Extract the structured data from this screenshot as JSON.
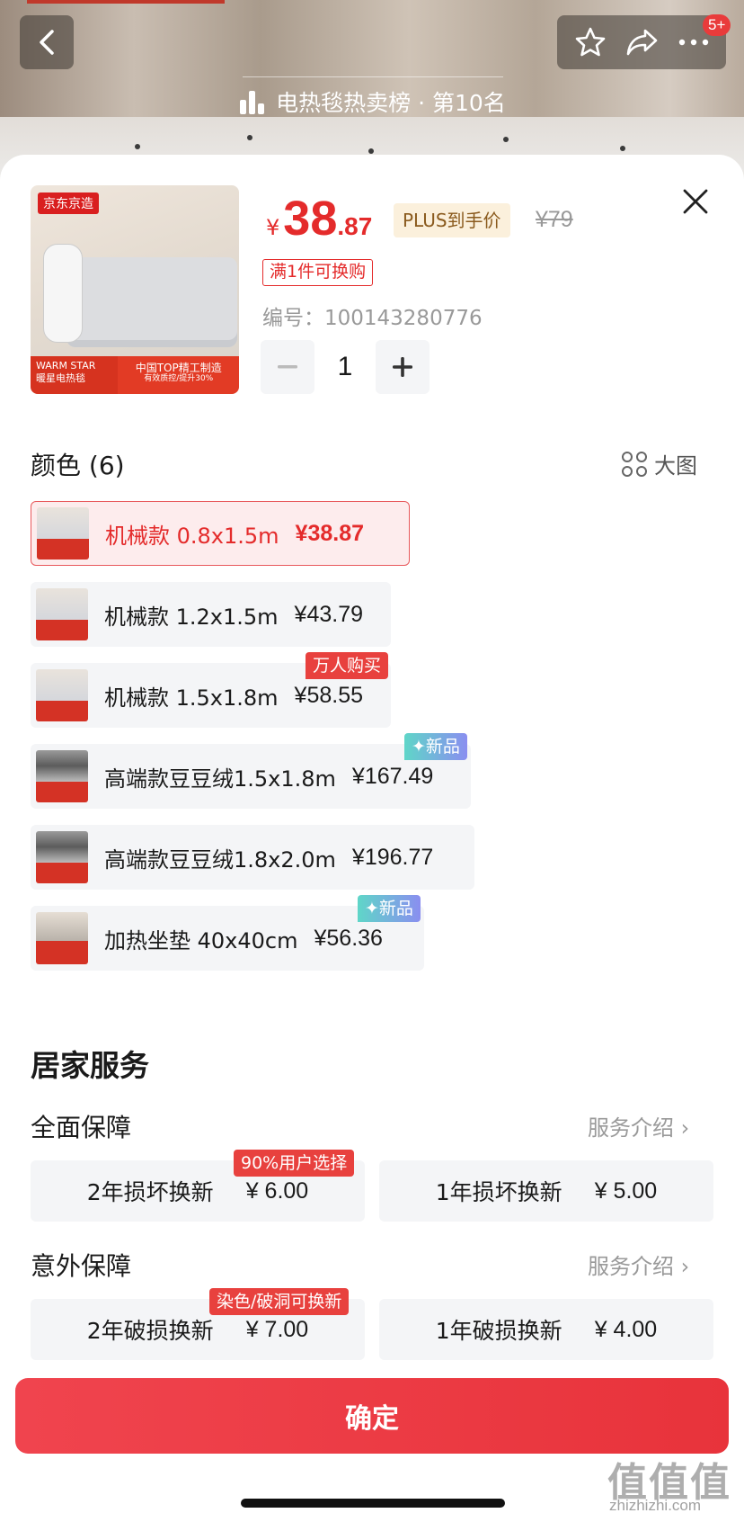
{
  "nav": {
    "badge": "5+",
    "rank_text": "电热毯热卖榜 · 第10名"
  },
  "product": {
    "price_symbol": "¥",
    "price_int": "38",
    "price_dec": ".87",
    "plus_label": "PLUS到手价",
    "original_price": "¥79",
    "promo": "满1件可换购",
    "sku_code": "编号：100143280776",
    "quantity": "1",
    "thumb": {
      "logo": "京东京造",
      "bar_left_1": "WARM STAR",
      "bar_left_2": "暖星电热毯",
      "bar_right_1": "中国TOP精工制造",
      "bar_right_2": "有效质控/提升30%"
    }
  },
  "color_section": {
    "title": "颜色 (6)",
    "big_view": "大图",
    "options": [
      {
        "name": "机械款 0.8x1.5m",
        "price": "¥38.87",
        "selected": true,
        "badge": ""
      },
      {
        "name": "机械款 1.2x1.5m",
        "price": "¥43.79",
        "selected": false,
        "badge": ""
      },
      {
        "name": "机械款 1.5x1.8m",
        "price": "¥58.55",
        "selected": false,
        "badge": "万人购买"
      },
      {
        "name": "高端款豆豆绒1.5x1.8m",
        "price": "¥167.49",
        "selected": false,
        "badge": "✦新品"
      },
      {
        "name": "高端款豆豆绒1.8x2.0m",
        "price": "¥196.77",
        "selected": false,
        "badge": ""
      },
      {
        "name": "加热坐垫 40x40cm",
        "price": "¥56.36",
        "selected": false,
        "badge": "✦新品"
      }
    ]
  },
  "home_service": {
    "title": "居家服务",
    "groups": [
      {
        "title": "全面保障",
        "intro": "服务介绍 ›",
        "items": [
          {
            "name": "2年损坏换新",
            "price": "¥ 6.00",
            "badge": "90%用户选择"
          },
          {
            "name": "1年损坏换新",
            "price": "¥ 5.00",
            "badge": ""
          }
        ]
      },
      {
        "title": "意外保障",
        "intro": "服务介绍 ›",
        "items": [
          {
            "name": "2年破损换新",
            "price": "¥ 7.00",
            "badge": "染色/破洞可换新"
          },
          {
            "name": "1年破损换新",
            "price": "¥ 4.00",
            "badge": ""
          }
        ]
      }
    ]
  },
  "confirm_label": "确定",
  "watermark": {
    "text": "值值值",
    "url": "zhizhizhi.com"
  },
  "colors": {
    "accent": "#e42b2b",
    "plus_bg": "#fbf0dc",
    "plus_text": "#8a5a1d"
  }
}
